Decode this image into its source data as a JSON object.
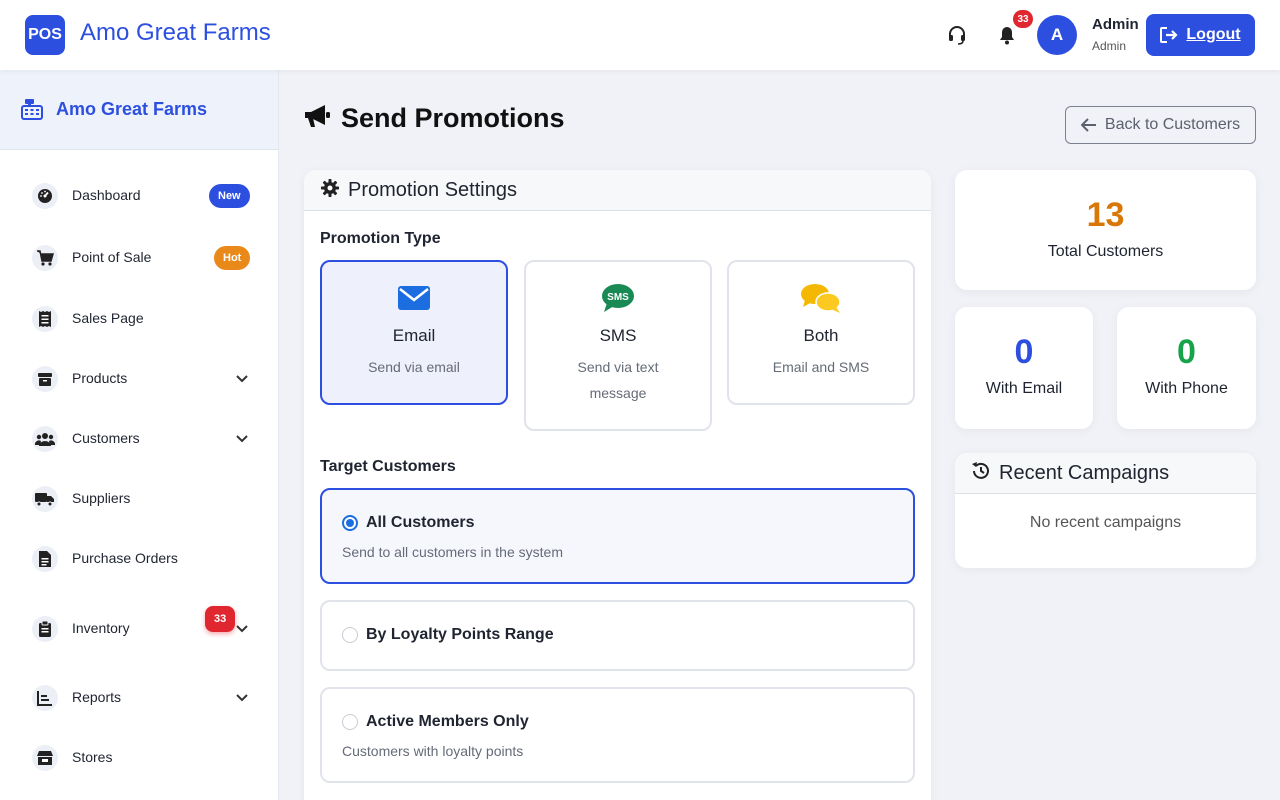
{
  "header": {
    "logo_text": "POS",
    "brand": "Amo Great Farms",
    "notification_count": "33",
    "avatar_initial": "A",
    "user_name": "Admin",
    "user_role": "Admin",
    "logout_label": "Logout"
  },
  "sidebar": {
    "brand": "Amo Great Farms",
    "items": [
      {
        "label": "Dashboard",
        "icon": "speedometer-icon",
        "badge": "New",
        "badge_color": "#2d4fe0",
        "has_chevron": false
      },
      {
        "label": "Point of Sale",
        "icon": "cart-icon",
        "badge": "Hot",
        "badge_color": "#e8891a",
        "has_chevron": false
      },
      {
        "label": "Sales Page",
        "icon": "receipt-icon",
        "badge": "",
        "has_chevron": false
      },
      {
        "label": "Products",
        "icon": "box-icon",
        "badge": "",
        "has_chevron": true
      },
      {
        "label": "Customers",
        "icon": "users-icon",
        "badge": "",
        "has_chevron": true
      },
      {
        "label": "Suppliers",
        "icon": "truck-icon",
        "badge": "",
        "has_chevron": false
      },
      {
        "label": "Purchase Orders",
        "icon": "document-icon",
        "badge": "",
        "has_chevron": false
      },
      {
        "label": "Inventory",
        "icon": "clipboard-icon",
        "badge": "33",
        "badge_color": "#e0262f",
        "has_chevron": true
      },
      {
        "label": "Reports",
        "icon": "chart-icon",
        "badge": "",
        "has_chevron": true
      },
      {
        "label": "Stores",
        "icon": "store-icon",
        "badge": "",
        "has_chevron": false
      }
    ]
  },
  "page": {
    "title": "Send Promotions",
    "back_label": "Back to Customers"
  },
  "settings": {
    "title": "Promotion Settings",
    "promotion_type_label": "Promotion Type",
    "types": [
      {
        "title": "Email",
        "desc": "Send via email",
        "icon": "envelope-icon",
        "selected": true
      },
      {
        "title": "SMS",
        "desc": "Send via text message",
        "icon": "sms-bubble-icon",
        "selected": false
      },
      {
        "title": "Both",
        "desc": "Email and SMS",
        "icon": "chat-bubbles-icon",
        "selected": false
      }
    ],
    "target_label": "Target Customers",
    "targets": [
      {
        "title": "All Customers",
        "desc": "Send to all customers in the system",
        "selected": true
      },
      {
        "title": "By Loyalty Points Range",
        "desc": "",
        "selected": false
      },
      {
        "title": "Active Members Only",
        "desc": "Customers with loyalty points",
        "selected": false
      }
    ]
  },
  "stats": {
    "total_customers": "13",
    "total_customers_label": "Total Customers",
    "with_email": "0",
    "with_email_label": "With Email",
    "with_phone": "0",
    "with_phone_label": "With Phone",
    "colors": {
      "total": "#d97706",
      "email": "#2d4fe0",
      "phone": "#16a34a"
    }
  },
  "recent": {
    "title": "Recent Campaigns",
    "empty": "No recent campaigns"
  }
}
